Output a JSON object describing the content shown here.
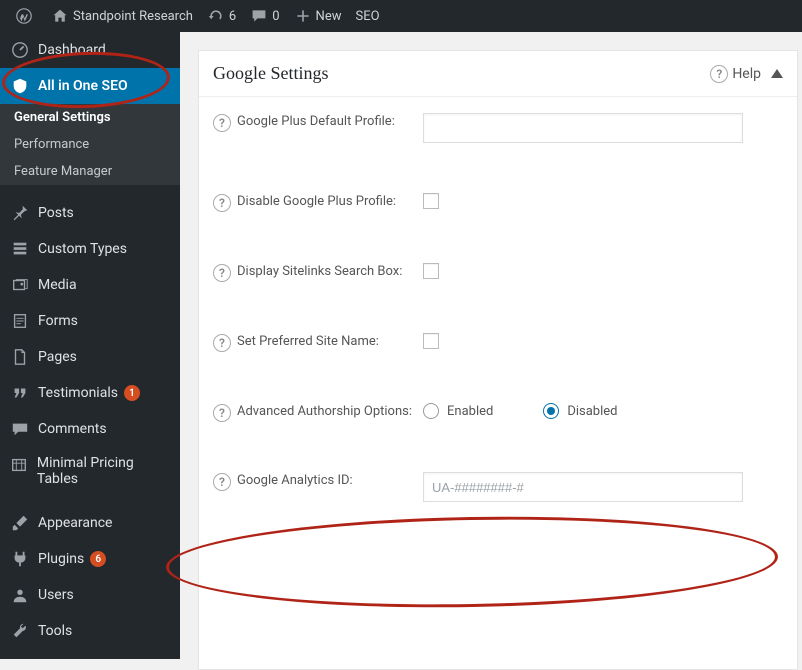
{
  "toolbar": {
    "site_name": "Standpoint Research",
    "updates_count": "6",
    "comments_count": "0",
    "new_label": "New",
    "seo_label": "SEO"
  },
  "sidebar": {
    "dashboard": "Dashboard",
    "aioseo": "All in One SEO",
    "sub": {
      "general": "General Settings",
      "performance": "Performance",
      "feature_mgr": "Feature Manager"
    },
    "posts": "Posts",
    "custom_types": "Custom Types",
    "media": "Media",
    "forms": "Forms",
    "pages": "Pages",
    "testimonials": "Testimonials",
    "testimonials_badge": "1",
    "comments": "Comments",
    "pricing": "Minimal Pricing Tables",
    "appearance": "Appearance",
    "plugins": "Plugins",
    "plugins_badge": "6",
    "users": "Users",
    "tools": "Tools"
  },
  "panel": {
    "title": "Google Settings",
    "help": "Help",
    "rows": {
      "gplus_profile": {
        "label": "Google Plus Default Profile:",
        "value": ""
      },
      "disable_gplus": {
        "label": "Disable Google Plus Profile:",
        "checked": false
      },
      "sitelinks": {
        "label": "Display Sitelinks Search Box:",
        "checked": false
      },
      "pref_site": {
        "label": "Set Preferred Site Name:",
        "checked": false
      },
      "authorship": {
        "label": "Advanced Authorship Options:",
        "enabled_label": "Enabled",
        "disabled_label": "Disabled",
        "value": "disabled"
      },
      "ga_id": {
        "label": "Google Analytics ID:",
        "placeholder": "UA-########-#",
        "value": ""
      }
    }
  }
}
